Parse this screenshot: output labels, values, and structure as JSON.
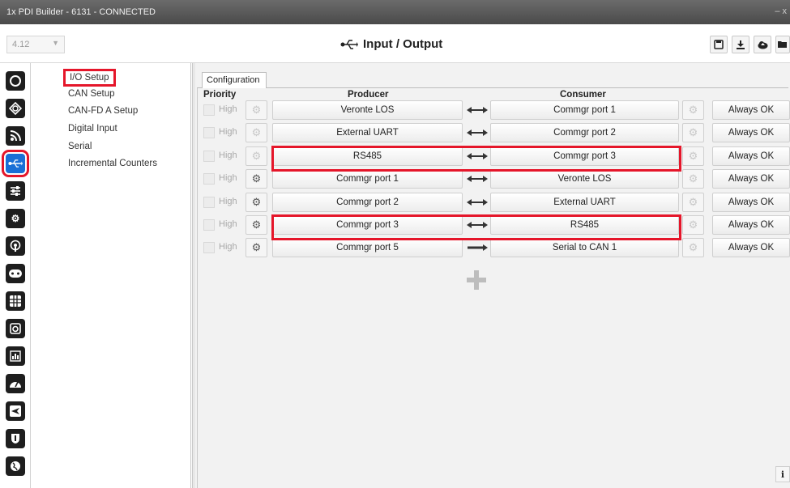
{
  "window": {
    "title": "1x PDI Builder - 6131 - CONNECTED",
    "control_glyph": "–  x"
  },
  "topbar": {
    "version": "4.12",
    "page_title": "Input / Output",
    "icon": "usb-icon",
    "buttons": [
      "save-icon",
      "download-icon",
      "cloud-upload-icon",
      "folder-open-icon"
    ]
  },
  "nav": {
    "icons": [
      "power-icon",
      "geometry-icon",
      "rss-icon",
      "usb-icon",
      "sliders-icon",
      "gears-icon",
      "beacon-icon",
      "gamepad-icon",
      "grid-icon",
      "camera-icon",
      "chart-icon",
      "dashboard-icon",
      "plane-icon",
      "shield-icon",
      "globe-icon"
    ],
    "active": "usb-icon"
  },
  "submenu": {
    "items": [
      {
        "label": "I/O Setup"
      },
      {
        "label": "CAN Setup"
      },
      {
        "label": "CAN-FD A Setup"
      },
      {
        "label": "Digital Input"
      },
      {
        "label": "Serial"
      },
      {
        "label": "Incremental Counters"
      }
    ],
    "active": "I/O Setup"
  },
  "tab": {
    "label": "Configuration"
  },
  "headers": {
    "priority": "Priority",
    "producer": "Producer",
    "consumer": "Consumer"
  },
  "rows": [
    {
      "high": "High",
      "producer": "Veronte LOS",
      "direction": "bidirectional",
      "consumer": "Commgr port 1",
      "status": "Always OK"
    },
    {
      "high": "High",
      "producer": "External UART",
      "direction": "bidirectional",
      "consumer": "Commgr port 2",
      "status": "Always OK"
    },
    {
      "high": "High",
      "producer": "RS485",
      "direction": "bidirectional",
      "consumer": "Commgr port 3",
      "status": "Always OK"
    },
    {
      "high": "High",
      "producer": "Commgr port 1",
      "direction": "bidirectional",
      "consumer": "Veronte LOS",
      "status": "Always OK"
    },
    {
      "high": "High",
      "producer": "Commgr port 2",
      "direction": "bidirectional",
      "consumer": "External UART",
      "status": "Always OK"
    },
    {
      "high": "High",
      "producer": "Commgr port 3",
      "direction": "bidirectional",
      "consumer": "RS485",
      "status": "Always OK"
    },
    {
      "high": "High",
      "producer": "Commgr port 5",
      "direction": "forward",
      "consumer": "Serial to CAN 1",
      "status": "Always OK"
    }
  ],
  "colors": {
    "highlight": "#e5162a",
    "active_nav": "#1a6fd6"
  }
}
